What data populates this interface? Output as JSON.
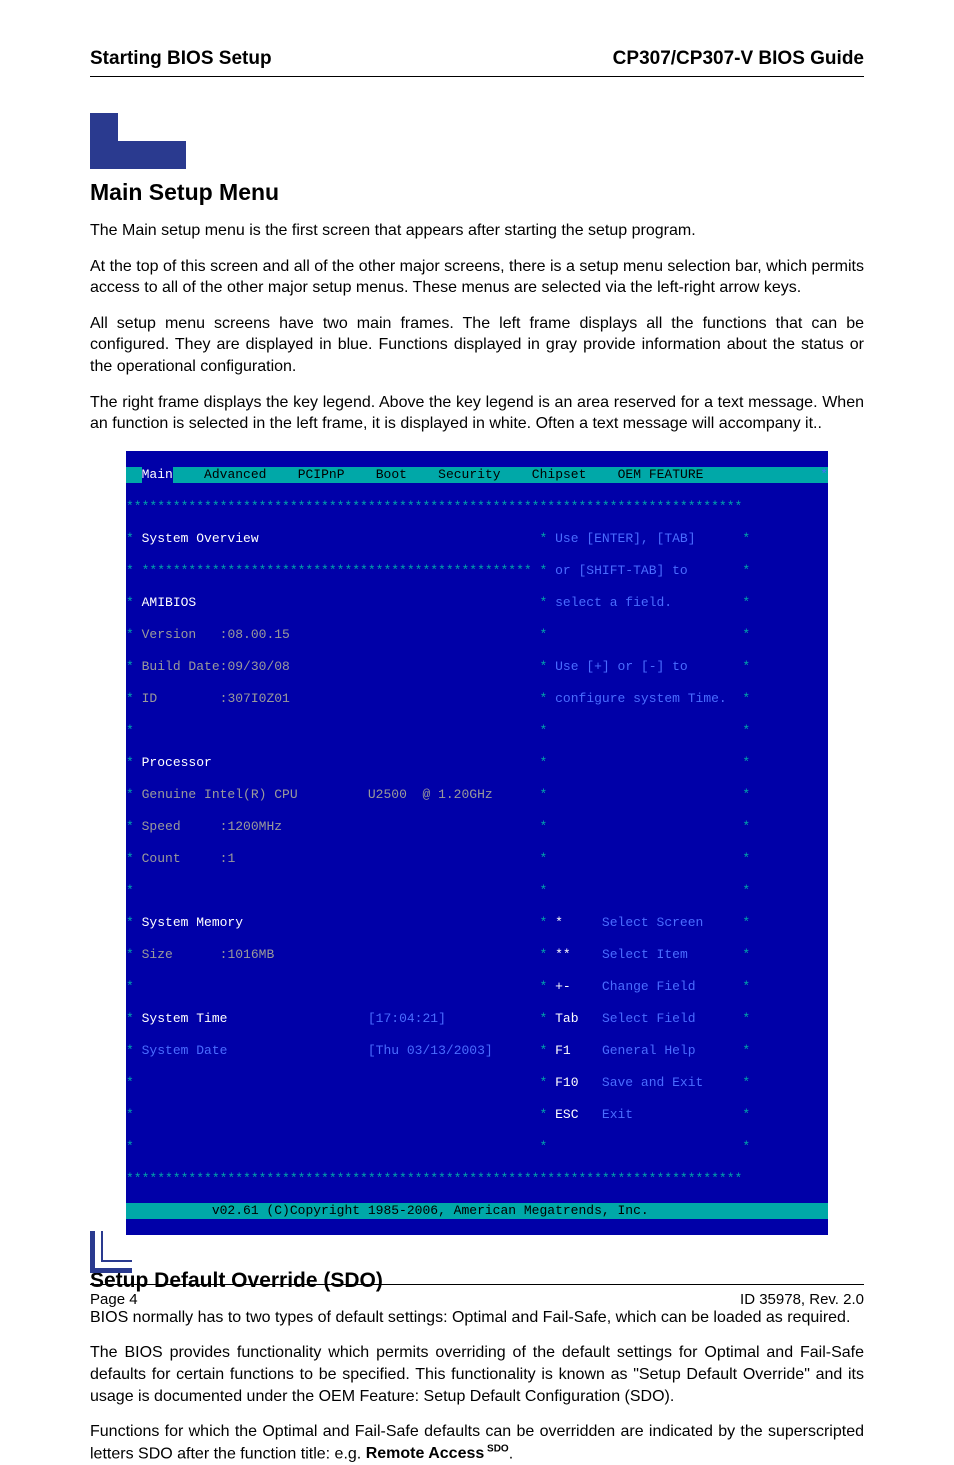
{
  "header": {
    "left": "Starting BIOS Setup",
    "right": "CP307/CP307-V BIOS Guide"
  },
  "section1": {
    "title": "Main Setup Menu",
    "p1": "The Main setup menu is the first screen that appears after starting the setup program.",
    "p2": "At the top of this screen and all of the other major screens, there is a setup menu selection bar, which permits access to all of the other major setup menus. These menus are selected via the left-right arrow keys.",
    "p3": "All setup menu screens have two main frames. The left frame displays all the functions that can be configured. They are displayed in blue. Functions displayed in gray provide information about the status or the operational configuration.",
    "p4": "The right frame displays the key legend. Above the key legend is an area reserved for a text message. When an function is selected in the left frame, it is displayed in white. Often a text message will accompany it.."
  },
  "bios": {
    "tabs": [
      "Main",
      "Advanced",
      "PCIPnP",
      "Boot",
      "Security",
      "Chipset",
      "OEM FEATURE"
    ],
    "l1": "System Overview",
    "l2": "AMIBIOS",
    "l3a": "Version   :",
    "l3b": "08.00.15",
    "l4a": "Build Date:",
    "l4b": "09/30/08",
    "l5a": "ID        :",
    "l5b": "307I0Z01",
    "l6": "Processor",
    "l7a": "Genuine Intel(R) CPU",
    "l7b": "U2500  @ 1.20GHz",
    "l8a": "Speed     :",
    "l8b": "1200MHz",
    "l9a": "Count     :",
    "l9b": "1",
    "l10": "System Memory",
    "l11a": "Size      :",
    "l11b": "1016MB",
    "l12a": "System Time",
    "l12b": "[17:04:21]",
    "l13a": "System Date",
    "l13b": "[Thu 03/13/2003]",
    "help1": "Use [ENTER], [TAB]",
    "help2": "or [SHIFT-TAB] to",
    "help3": "select a field.",
    "help4": "Use [+] or [-] to",
    "help5": "configure system Time.",
    "k1a": "*",
    "k1b": "Select Screen",
    "k2a": "**",
    "k2b": "Select Item",
    "k3a": "+-",
    "k3b": "Change Field",
    "k4a": "Tab",
    "k4b": "Select Field",
    "k5a": "F1",
    "k5b": "General Help",
    "k6a": "F10",
    "k6b": "Save and Exit",
    "k7a": "ESC",
    "k7b": "Exit",
    "copyright": "v02.61 (C)Copyright 1985-2006, American Megatrends, Inc."
  },
  "section2": {
    "title": "Setup Default Override (SDO)",
    "p1": "BIOS normally has to two types of default settings: Optimal and Fail-Safe, which can be loaded as required.",
    "p2": "The BIOS provides functionality which permits overriding of the default settings for Optimal and Fail-Safe defaults for certain functions to be specified. This functionality is known as \"Setup Default Override\" and its usage is documented under the OEM Feature: Setup Default Configuration (SDO).",
    "p3a": "Functions for which the Optimal and Fail-Safe defaults can be overridden are indicated by the superscripted letters SDO after the function title: e.g. ",
    "p3b": "Remote Access",
    "p3c": " SDO",
    "p3d": "."
  },
  "footer": {
    "left": "Page 4",
    "right": "ID 35978, Rev. 2.0"
  }
}
